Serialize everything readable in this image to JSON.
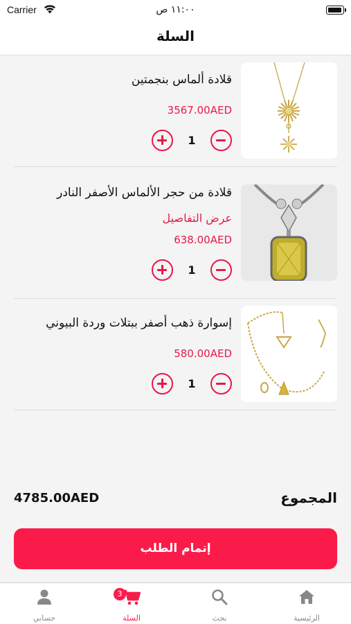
{
  "status_bar": {
    "carrier": "Carrier",
    "time": "١١:٠٠ ص"
  },
  "nav": {
    "title": "السلة"
  },
  "cart": {
    "items": [
      {
        "name": "قلادة ألماس بنجمتين",
        "link": "",
        "price": "3567.00AED",
        "qty": "1"
      },
      {
        "name": "قلادة من حجر الألماس الأصفر النادر",
        "link": "عرض التفاصيل",
        "price": "638.00AED",
        "qty": "1"
      },
      {
        "name": "إسوارة ذهب أصفر ببتلات وردة البيوني",
        "link": "",
        "price": "580.00AED",
        "qty": "1"
      }
    ]
  },
  "summary": {
    "label": "المجموع",
    "amount": "4785.00AED"
  },
  "checkout": {
    "label": "إتمام الطلب"
  },
  "tabbar": {
    "tabs": [
      {
        "label": "الرئيسية",
        "icon": "home-icon"
      },
      {
        "label": "بحث",
        "icon": "search-icon"
      },
      {
        "label": "السلة",
        "icon": "cart-icon",
        "badge": "3"
      },
      {
        "label": "حسابي",
        "icon": "person-icon"
      }
    ]
  },
  "colors": {
    "accent": "#fb1b4b",
    "price": "#e8174a",
    "tab_inactive": "#888888"
  }
}
